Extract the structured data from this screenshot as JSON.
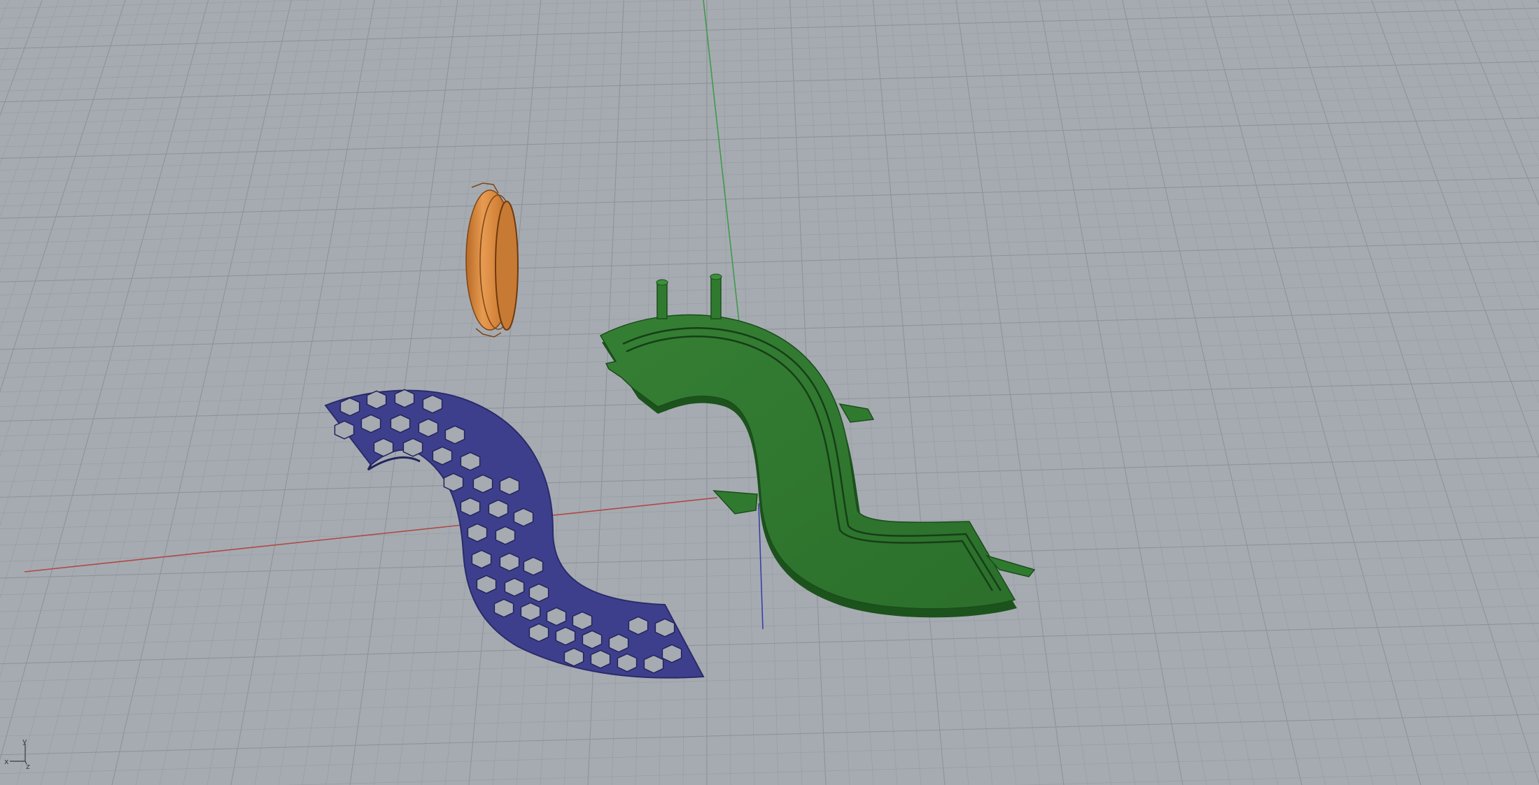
{
  "viewport": {
    "background_color": "#a6abb2",
    "grid_minor_color": "#989da4",
    "grid_major_color": "#8e939a"
  },
  "axes": {
    "x_axis_color": "#b04a44",
    "y_axis_color": "#3f9a4a",
    "z_axis_color": "#3b3fa6"
  },
  "axis_gizmo": {
    "x_label": "x",
    "y_label": "y",
    "z_label": "z"
  },
  "objects": [
    {
      "name": "orange-ring-part",
      "color": "#d9883a"
    },
    {
      "name": "blue-hexagon-lattice-part",
      "color": "#3e3f8c"
    },
    {
      "name": "green-channel-part",
      "color": "#2e7a2e"
    }
  ]
}
